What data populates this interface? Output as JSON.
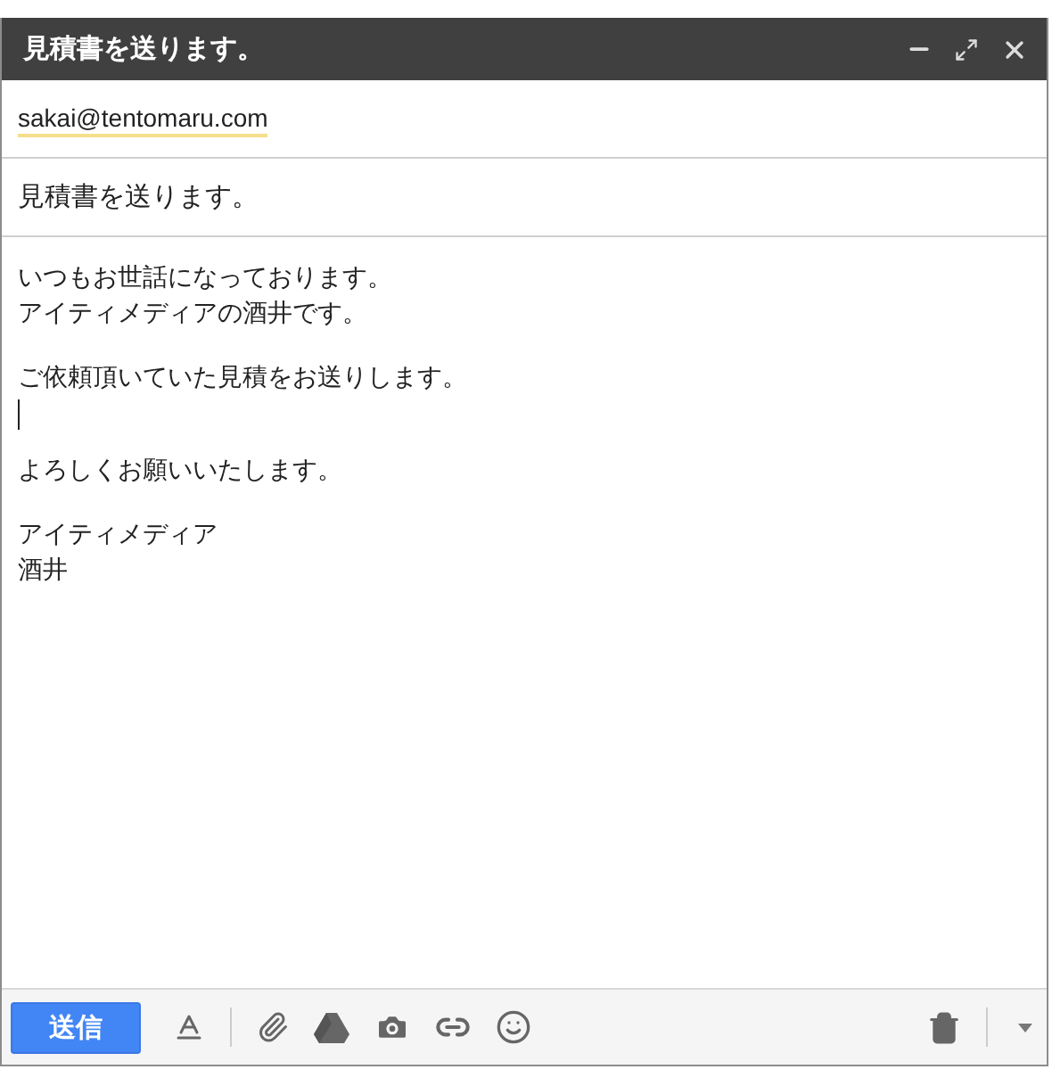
{
  "window": {
    "title": "見積書を送ります。"
  },
  "recipient": {
    "value": "sakai@tentomaru.com"
  },
  "subject": {
    "value": "見積書を送ります。"
  },
  "body": {
    "paragraphs": [
      {
        "lines": [
          "いつもお世話になっております。",
          "アイティメディアの酒井です。"
        ],
        "cursor_after": false
      },
      {
        "lines": [
          "ご依頼頂いていた見積をお送りします。"
        ],
        "cursor_after": true
      },
      {
        "lines": [
          "よろしくお願いいたします。"
        ],
        "cursor_after": false
      },
      {
        "lines": [
          "アイティメディア",
          "酒井"
        ],
        "cursor_after": false
      }
    ]
  },
  "toolbar": {
    "send_label": "送信"
  }
}
